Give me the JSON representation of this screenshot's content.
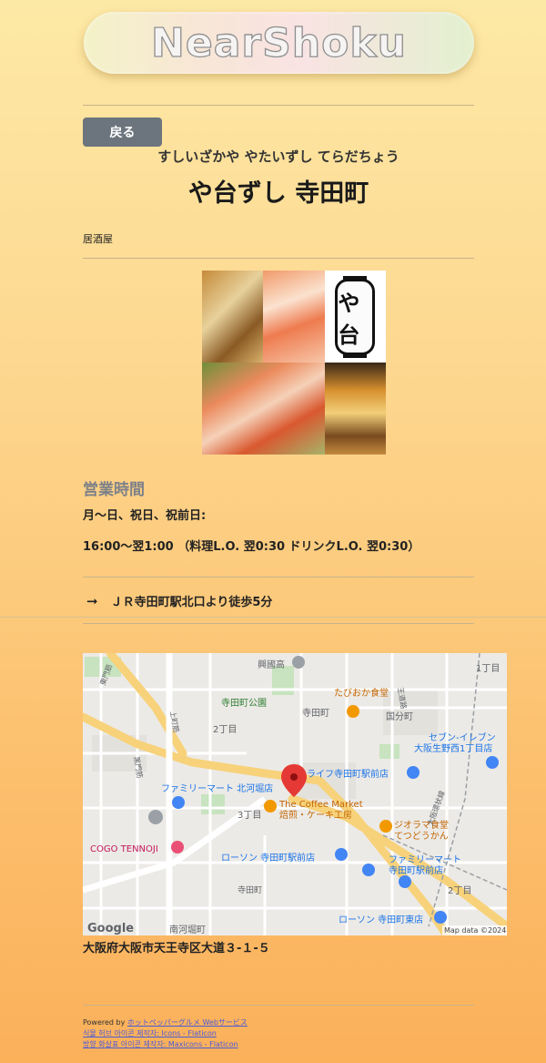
{
  "header": {
    "logo_text": "NearShoku"
  },
  "nav": {
    "back_label": "戻る"
  },
  "shop": {
    "name_kana": "すしいざかや やたいずし てらだちょう",
    "name": "や台ずし 寺田町",
    "genre": "居酒屋",
    "lantern_text": "や台"
  },
  "hours": {
    "title": "営業時間",
    "days": "月〜日、祝日、祝前日:",
    "times": "16:00〜翌1:00 （料理L.O. 翌0:30 ドリンクL.O. 翌0:30）"
  },
  "access": {
    "icon": "arrow-right-icon",
    "text": "ＪＲ寺田町駅北口より徒歩5分"
  },
  "map": {
    "labels": {
      "kokko": "興國高",
      "tabioka": "たびおか食堂",
      "teradacho_park": "寺田町公園",
      "teradacho": "寺田町",
      "kokubuncho": "国分町",
      "seven": "セブン-イレブン",
      "seven2": "大阪生野西1丁目店",
      "life": "ライフ寺田町駅前店",
      "familymart1": "ファミリーマート 北河堀店",
      "coffee": "The Coffee Market",
      "coffee2": "焙煎・ケーキ工房",
      "dioramma": "ジオラマ食堂",
      "dioramma2": "てつどうかん",
      "cogo": "COGO TENNOJI",
      "lawson1": "ローソン 寺田町駅前店",
      "familymart2": "ファミリーマート",
      "familymart2b": "寺田町駅前店",
      "teradacho_st": "寺田町",
      "lawson2": "ローソン 寺田町東店",
      "minami": "南河堀町",
      "ch2": "2丁目",
      "ch3": "3丁目",
      "ch1": "1丁目",
      "ch2b": "2丁目",
      "ohji": "王道路",
      "higashi": "東門筋",
      "ueno": "上町筋",
      "kuromon": "黒門筋",
      "ocho": "大阪環状線",
      "google": "Google",
      "attribution": "Map data ©2024"
    }
  },
  "address": "大阪府大阪市天王寺区大道３-１-５",
  "footer": {
    "powered_prefix": "Powered by ",
    "powered_link": "ホットペッパーグルメ Webサービス",
    "credit1": "식물 허브 아이콘 제작자: Icons - Flaticon",
    "credit2": "방향 화살표 아이콘 제작자: Maxicons - Flaticon"
  }
}
